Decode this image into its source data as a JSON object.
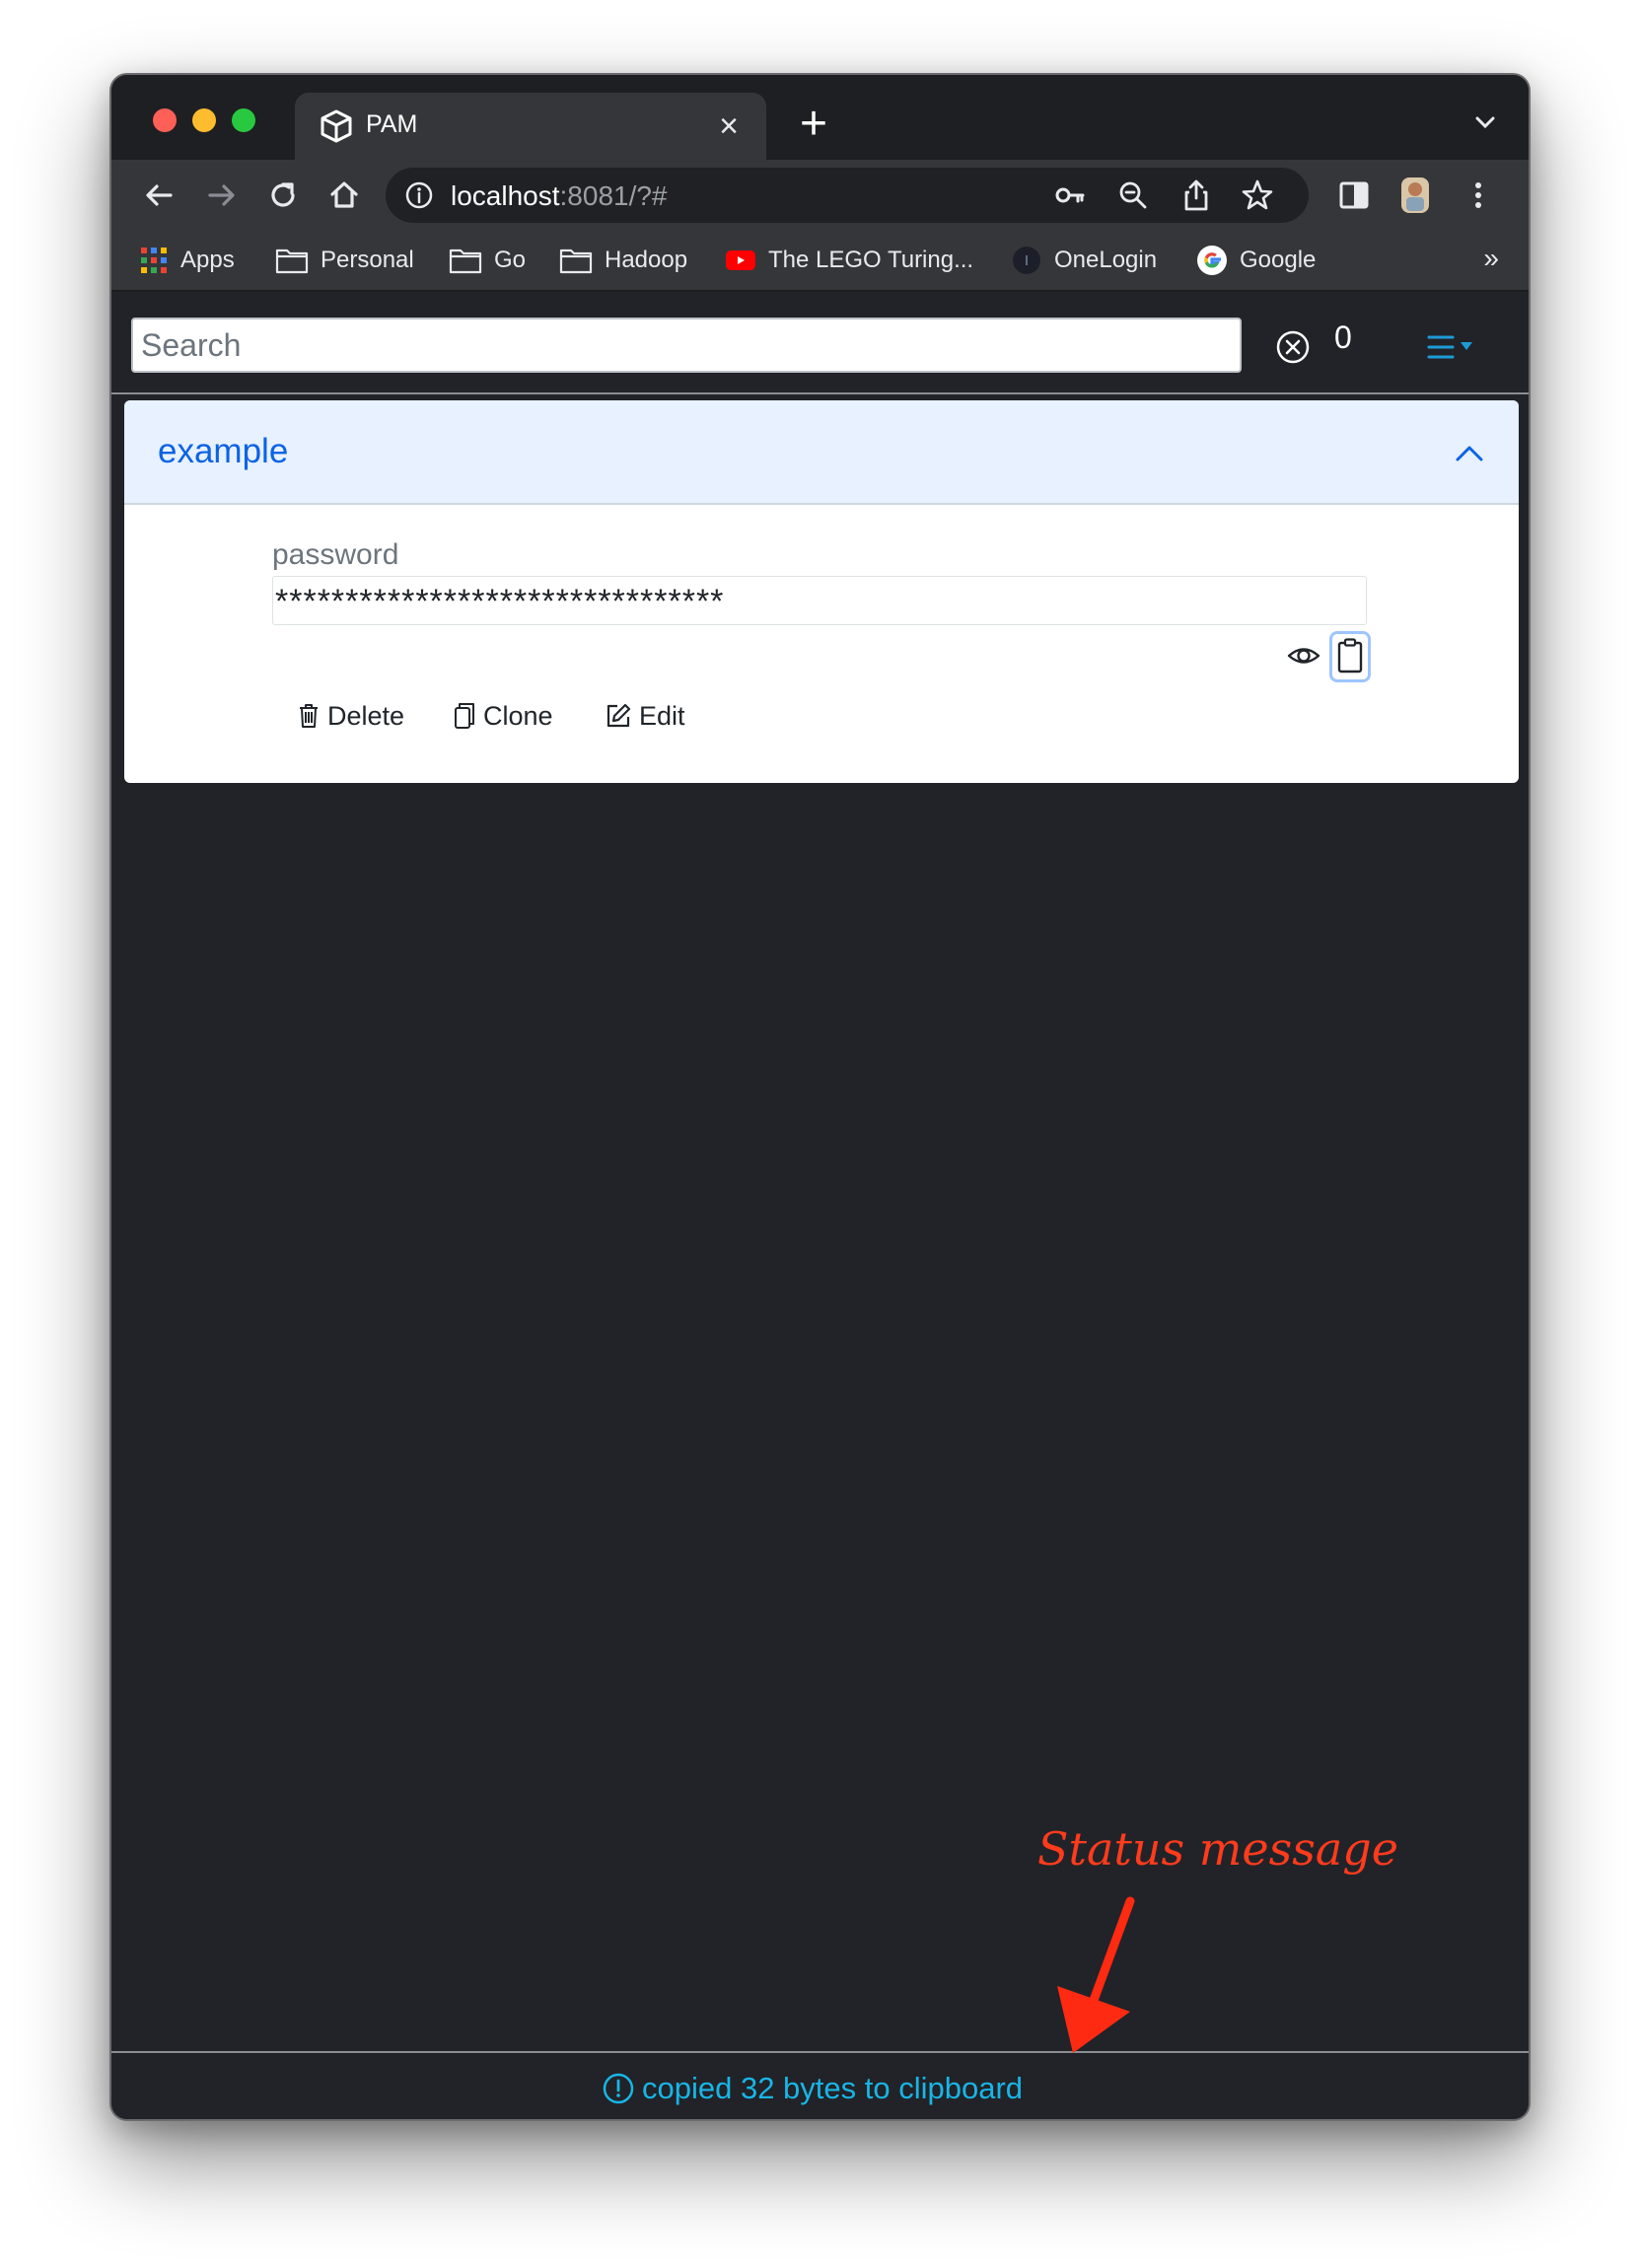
{
  "browser": {
    "tab_title": "PAM",
    "url_host": "localhost",
    "url_rest": ":8081/?#",
    "bookmarks": [
      {
        "label": "Apps",
        "icon": "apps-grid-icon"
      },
      {
        "label": "Personal",
        "icon": "folder-icon"
      },
      {
        "label": "Go",
        "icon": "folder-icon"
      },
      {
        "label": "Hadoop",
        "icon": "folder-icon"
      },
      {
        "label": "The LEGO Turing...",
        "icon": "youtube-icon"
      },
      {
        "label": "OneLogin",
        "icon": "onelogin-icon"
      },
      {
        "label": "Google",
        "icon": "google-icon"
      }
    ],
    "more_bookmarks": "»"
  },
  "app": {
    "search": {
      "placeholder": "Search",
      "value": ""
    },
    "result_count": "0",
    "entry": {
      "title": "example",
      "field_label": "password",
      "field_value": "********************************"
    },
    "actions": {
      "delete": "Delete",
      "clone": "Clone",
      "edit": "Edit"
    },
    "status": "copied 32 bytes to clipboard"
  },
  "annotation": {
    "text": "Status message",
    "color": "#fe3b1c"
  },
  "colors": {
    "accent": "#0c63e4",
    "status": "#19b5e6",
    "header_bg": "#e7f1ff",
    "app_bg": "#212328"
  }
}
